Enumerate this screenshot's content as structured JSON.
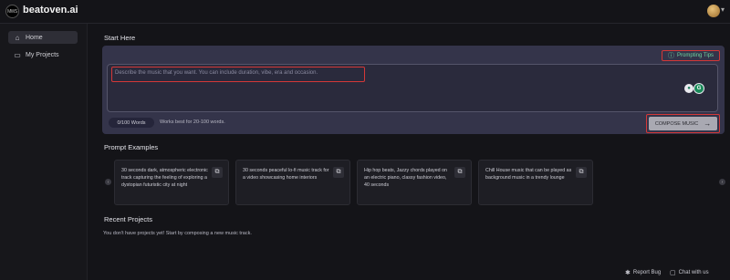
{
  "app": {
    "logo_text": "beatoven.ai",
    "logo_mark_text": "MWS"
  },
  "sidebar": {
    "items": [
      {
        "label": "Home",
        "icon": "home-icon",
        "active": true
      },
      {
        "label": "My Projects",
        "icon": "projects-icon",
        "active": false
      }
    ]
  },
  "compose": {
    "title": "Start Here",
    "tips_label": "Prompting Tips",
    "placeholder": "Describe the music that you want. You can include duration, vibe, era and occasion.",
    "word_count": "0/100 Words",
    "word_hint": "Works best for 20-100 words.",
    "compose_label": "COMPOSE MUSIC",
    "ext_icon_2_text": "G"
  },
  "examples": {
    "title": "Prompt Examples",
    "cards": [
      {
        "text": "30 seconds dark, atmospheric electronic track capturing the feeling of exploring a dystopian futuristic city at night"
      },
      {
        "text": "30 seconds peaceful lo-fi music track for a video showcasing home interiors"
      },
      {
        "text": "Hip hop beats, Jazzy chords played on an electric piano, classy fashion video, 40 seconds"
      },
      {
        "text": "Chill House music that can be played as background music in a trendy lounge"
      }
    ]
  },
  "recent": {
    "title": "Recent Projects",
    "empty_message": "You don't have projects yet! Start by composing a new music track."
  },
  "footer": {
    "report_bug": "Report Bug",
    "chat": "Chat with us"
  },
  "colors": {
    "highlight": "#d43838",
    "accent_green": "#6fd4a0",
    "panel": "#34344a"
  }
}
